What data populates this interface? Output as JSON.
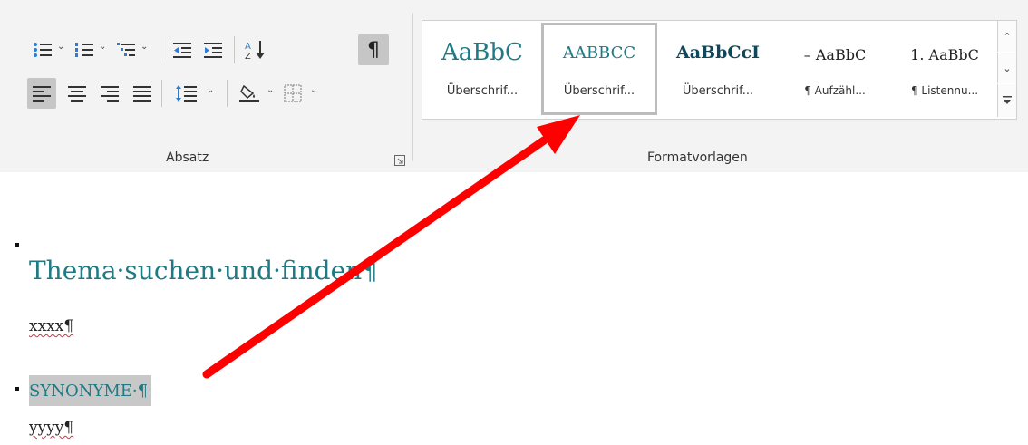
{
  "ribbon": {
    "paragraph_group": {
      "label": "Absatz",
      "pilcrow": "¶"
    },
    "styles_group": {
      "label": "Formatvorlagen",
      "styles": [
        {
          "preview": "AaBbC",
          "name": "Überschrif..."
        },
        {
          "preview": "AABBCC",
          "name": "Überschrif...",
          "selected": true
        },
        {
          "preview": "AaBbCcI",
          "name": "Überschrif..."
        },
        {
          "preview": "– AaBbC",
          "name": "¶ Aufzähl..."
        },
        {
          "preview": "1. AaBbC",
          "name": "¶ Listennu..."
        }
      ]
    }
  },
  "document": {
    "heading": "Thema·suchen·und·finden¶",
    "line1": "xxxx¶",
    "highlighted": "SYNONYME·¶",
    "line2": "yyyy¶"
  },
  "colors": {
    "heading": "#1f7a84",
    "arrow": "#ff0000",
    "highlight": "#c8c8c8"
  }
}
